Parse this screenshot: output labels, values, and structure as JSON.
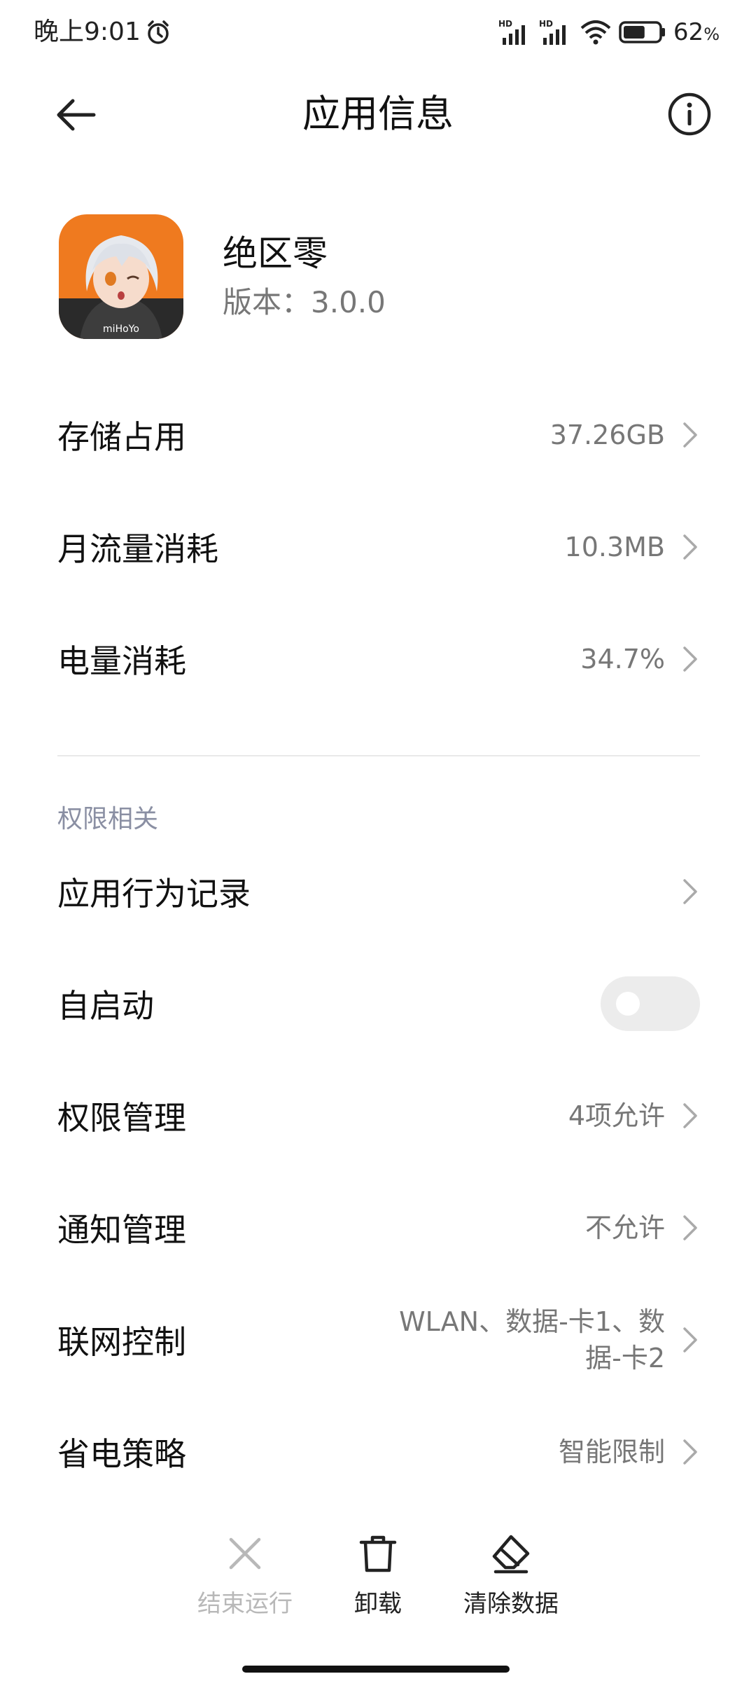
{
  "status_bar": {
    "time": "晚上9:01",
    "battery": "62",
    "battery_unit": "%",
    "battery_level": 0.62
  },
  "header": {
    "title": "应用信息"
  },
  "app": {
    "name": "绝区零",
    "version": "版本：3.0.0",
    "icon_brand": "miHoYo",
    "icon_bg": "#ef7a1f"
  },
  "usage": [
    {
      "label": "存储占用",
      "value": "37.26GB"
    },
    {
      "label": "月流量消耗",
      "value": "10.3MB"
    },
    {
      "label": "电量消耗",
      "value": "34.7%"
    }
  ],
  "section_title": "权限相关",
  "permissions": {
    "behavior_log": {
      "label": "应用行为记录"
    },
    "autostart": {
      "label": "自启动",
      "enabled": false
    },
    "permission_mgmt": {
      "label": "权限管理",
      "value": "4项允许"
    },
    "notification_mgmt": {
      "label": "通知管理",
      "value": "不允许"
    },
    "network_control": {
      "label": "联网控制",
      "value_line1": "WLAN、数据-卡1、数",
      "value_line2": "据-卡2"
    },
    "power_policy": {
      "label": "省电策略",
      "value": "智能限制"
    }
  },
  "bottom_bar": {
    "force_stop": {
      "label": "结束运行",
      "disabled": true
    },
    "uninstall": {
      "label": "卸载"
    },
    "clear_data": {
      "label": "清除数据"
    }
  },
  "colors": {
    "text_primary": "#111111",
    "text_secondary": "#777777",
    "section": "#8a8fa3",
    "disabled": "#b8b8b8",
    "divider": "#e9e9e9"
  }
}
